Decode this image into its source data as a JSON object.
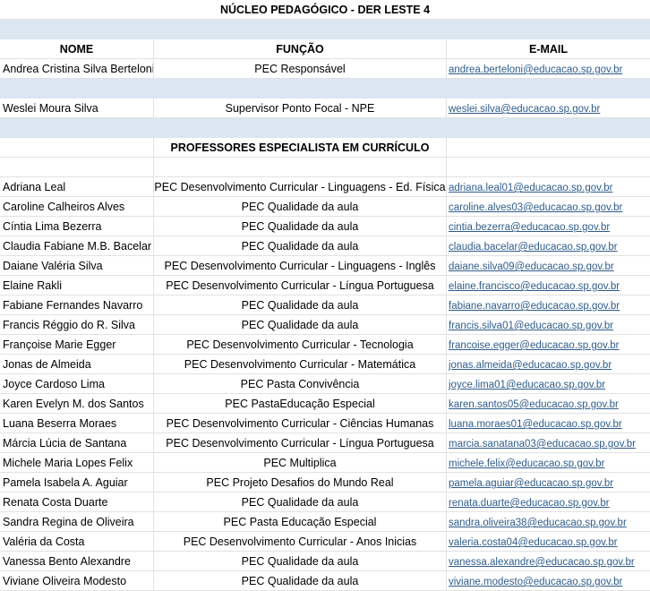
{
  "title": "NÚCLEO PEDAGÓGICO - DER LESTE 4",
  "headers": {
    "name": "NOME",
    "role": "FUNÇÃO",
    "email": "E-MAIL"
  },
  "leaders": [
    {
      "name": "Andrea Cristina Silva Berteloni",
      "role": "PEC Responsável",
      "email": "andrea.berteloni@educacao.sp.gov.br"
    },
    {
      "name": "Weslei Moura Silva",
      "role": "Supervisor Ponto Focal - NPE",
      "email": "weslei.silva@educacao.sp.gov.br"
    }
  ],
  "section_title": "PROFESSORES ESPECIALISTA EM CURRÍCULO",
  "teachers": [
    {
      "name": "Adriana Leal",
      "role": "PEC Desenvolvimento Curricular - Linguagens - Ed. Física",
      "email": "adriana.leal01@educacao.sp.gov.br"
    },
    {
      "name": "Caroline Calheiros Alves",
      "role": "PEC Qualidade da aula",
      "email": "caroline.alves03@educacao.sp.gov.br"
    },
    {
      "name": "Cíntia Lima Bezerra",
      "role": "PEC Qualidade da aula",
      "email": "cintia.bezerra@educacao.sp.gov.br"
    },
    {
      "name": "Claudia Fabiane M.B. Bacelar",
      "role": "PEC Qualidade da aula",
      "email": "claudia.bacelar@educacao.sp.gov.br"
    },
    {
      "name": "Daiane Valéria Silva",
      "role": "PEC Desenvolvimento Curricular - Linguagens - Inglês",
      "email": "daiane.silva09@educacao.sp.gov.br"
    },
    {
      "name": "Elaine Rakli",
      "role": "PEC Desenvolvimento Curricular - Língua Portuguesa",
      "email": "elaine.francisco@educacao.sp.gov.br"
    },
    {
      "name": "Fabiane Fernandes Navarro",
      "role": "PEC Qualidade da aula",
      "email": "fabiane.navarro@educacao.sp.gov.br"
    },
    {
      "name": "Francis Réggio do R. Silva",
      "role": "PEC Qualidade da aula",
      "email": "francis.silva01@educacao.sp.gov.br"
    },
    {
      "name": "Françoise Marie Egger",
      "role": "PEC Desenvolvimento Curricular - Tecnologia",
      "email": "francoise.egger@educacao.sp.gov.br"
    },
    {
      "name": "Jonas de Almeida",
      "role": "PEC Desenvolvimento Curricular - Matemática",
      "email": "jonas.almeida@educacao.sp.gov.br"
    },
    {
      "name": "Joyce Cardoso Lima",
      "role": "PEC Pasta Convivência",
      "email": "joyce.lima01@educacao.sp.gov.br"
    },
    {
      "name": "Karen Evelyn M. dos Santos",
      "role": "PEC PastaEducação Especial",
      "email": "karen.santos05@educacao.sp.gov.br"
    },
    {
      "name": "Luana Beserra Moraes",
      "role": "PEC Desenvolvimento Curricular - Ciências Humanas",
      "email": "luana.moraes01@educacao.sp.gov.br"
    },
    {
      "name": "Márcia Lúcia de Santana",
      "role": "PEC Desenvolvimento Curricular - Língua Portuguesa",
      "email": "marcia.sanatana03@educacao.sp.gov.br"
    },
    {
      "name": "Michele Maria Lopes Felix",
      "role": "PEC Multiplica",
      "email": "michele.felix@educacao.sp.gov.br"
    },
    {
      "name": "Pamela Isabela A. Aguiar",
      "role": "PEC Projeto Desafios do Mundo Real",
      "email": "pamela.aguiar@educacao.sp.gov.br"
    },
    {
      "name": "Renata Costa Duarte",
      "role": "PEC Qualidade da aula",
      "email": "renata.duarte@educacao.sp.gov.br"
    },
    {
      "name": "Sandra Regina de Oliveira",
      "role": "PEC Pasta Educação Especial",
      "email": "sandra.oliveira38@educacao.sp.gov.br"
    },
    {
      "name": "Valéria da Costa",
      "role": "PEC Desenvolvimento Curricular - Anos Inicias",
      "email": "valeria.costa04@educacao.sp.gov.br"
    },
    {
      "name": "Vanessa Bento Alexandre",
      "role": "PEC Qualidade da aula",
      "email": "vanessa.alexandre@educacao.sp.gov.br"
    },
    {
      "name": "Viviane Oliveira Modesto",
      "role": "PEC Qualidade da aula",
      "email": "viviane.modesto@educacao.sp.gov.br"
    }
  ],
  "colors": {
    "band": "#dce6f1",
    "link": "#2f5c8a",
    "grid": "#e2e2e2"
  }
}
